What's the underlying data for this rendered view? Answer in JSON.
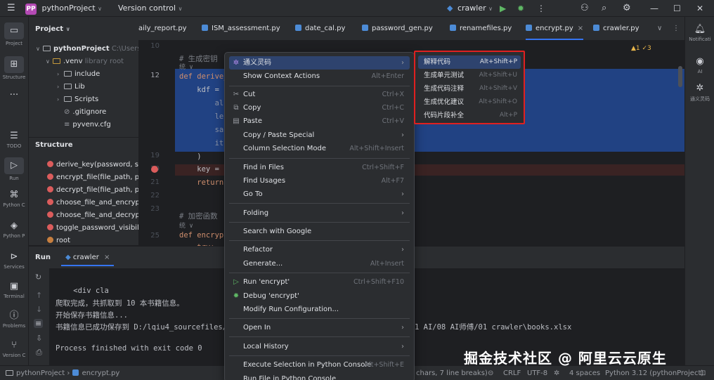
{
  "titlebar": {
    "project_badge": "PP",
    "project_name": "pythonProject",
    "vcs": "Version control",
    "run_config": "crawler"
  },
  "left_tools": {
    "project": "Project",
    "structure": "Structure",
    "todo": "TODO",
    "run": "Run",
    "python_console": "Python C",
    "python_packages": "Python P",
    "services": "Services",
    "terminal": "Terminal",
    "problems": "Problems",
    "version_control": "Version C"
  },
  "right_tools": {
    "notifications": "Notificati",
    "ai": "AI",
    "tongyi": "通义灵码"
  },
  "project_panel": {
    "title": "Project",
    "root_name": "pythonProject",
    "root_path": "C:\\Users\\",
    "venv": ".venv",
    "venv_note": "library root",
    "items": [
      "include",
      "Lib",
      "Scripts",
      ".gitignore",
      "pyvenv.cfg"
    ]
  },
  "structure_panel": {
    "title": "Structure",
    "items": [
      "derive_key(password, salt)",
      "encrypt_file(file_path, pass",
      "decrypt_file(file_path, pass",
      "choose_file_and_encrypt()",
      "choose_file_and_decrypt()",
      "toggle_password_visibility(",
      "root"
    ]
  },
  "tabs": [
    {
      "label": "aily_report.py",
      "active": false
    },
    {
      "label": "ISM_assessment.py",
      "active": false
    },
    {
      "label": "date_cal.py",
      "active": false
    },
    {
      "label": "password_gen.py",
      "active": false
    },
    {
      "label": "renamefiles.py",
      "active": false
    },
    {
      "label": "encrypt.py",
      "active": true
    },
    {
      "label": "crawler.py",
      "active": false
    }
  ],
  "editor": {
    "inspections": "▲1  ✓3",
    "line_numbers": [
      "10",
      "11",
      "12",
      "13",
      "14",
      "15",
      "16",
      "17",
      "18",
      "19",
      "20",
      "21",
      "22",
      "23",
      "24",
      "25",
      "26"
    ],
    "lines": [
      "",
      "# 生成密钥",
      "def derive_",
      "    kdf = P",
      "        al",
      "        le",
      "        sa",
      "        it",
      "        ba",
      "    )",
      "    key = k",
      "    return",
      "",
      "",
      "# 加密函数",
      "def encrypt",
      "    try:"
    ],
    "hint_label": "统 ∨"
  },
  "run_panel": {
    "title": "Run",
    "tab": "crawler",
    "console": [
      "    <div cla",
      "爬取完成，共抓取到 10 本书籍信息。",
      "开始保存书籍信息...",
      "书籍信息已成功保存到 D:/lqiu4_sourcefiles/01",
      "",
      "Process finished with exit code 0"
    ],
    "console_tail": "1 AI/08 AI师傅/01 crawler\\books.xlsx"
  },
  "status": {
    "project": "pythonProject",
    "file": "encrypt.py",
    "selection": "chars, 7 line breaks)",
    "line_sep": "CRLF",
    "encoding": "UTF-8",
    "indent": "4 spaces",
    "interpreter": "Python 3.12 (pythonProject)"
  },
  "context_menu": {
    "items": [
      {
        "label": "通义灵码",
        "shortcut": "",
        "submenu": true,
        "highlighted": true,
        "icon": "tongyi-icon"
      },
      {
        "label": "Show Context Actions",
        "shortcut": "Alt+Enter",
        "icon": "bulb-icon"
      },
      {
        "label": "Cut",
        "shortcut": "Ctrl+X",
        "icon": "scissors-icon"
      },
      {
        "label": "Copy",
        "shortcut": "Ctrl+C",
        "icon": "copy-icon"
      },
      {
        "label": "Paste",
        "shortcut": "Ctrl+V",
        "icon": "paste-icon"
      },
      {
        "label": "Copy / Paste Special",
        "submenu": true
      },
      {
        "label": "Column Selection Mode",
        "shortcut": "Alt+Shift+Insert"
      },
      {
        "label": "Find in Files",
        "shortcut": "Ctrl+Shift+F"
      },
      {
        "label": "Find Usages",
        "shortcut": "Alt+F7"
      },
      {
        "label": "Go To",
        "submenu": true
      },
      {
        "label": "Folding",
        "submenu": true
      },
      {
        "label": "Search with Google"
      },
      {
        "label": "Refactor",
        "submenu": true
      },
      {
        "label": "Generate...",
        "shortcut": "Alt+Insert"
      },
      {
        "label": "Run 'encrypt'",
        "shortcut": "Ctrl+Shift+F10",
        "icon": "run-icon"
      },
      {
        "label": "Debug 'encrypt'",
        "icon": "debug-icon"
      },
      {
        "label": "Modify Run Configuration..."
      },
      {
        "label": "Open In",
        "submenu": true
      },
      {
        "label": "Local History",
        "submenu": true
      },
      {
        "label": "Execute Selection in Python Console",
        "shortcut": "Alt+Shift+E"
      },
      {
        "label": "Run File in Python Console"
      }
    ]
  },
  "submenu": {
    "items": [
      {
        "label": "解释代码",
        "shortcut": "Alt+Shift+P",
        "highlighted": true
      },
      {
        "label": "生成单元测试",
        "shortcut": "Alt+Shift+U"
      },
      {
        "label": "生成代码注释",
        "shortcut": "Alt+Shift+V"
      },
      {
        "label": "生成优化建议",
        "shortcut": "Alt+Shift+O"
      },
      {
        "label": "代码片段补全",
        "shortcut": "Alt+P"
      }
    ]
  },
  "watermark": "掘金技术社区 @ 阿里云云原生",
  "colors": {
    "selection": "#214283",
    "accent": "#3574f0",
    "highlight_border": "#e02020",
    "menu_highlight": "#2e436e"
  }
}
